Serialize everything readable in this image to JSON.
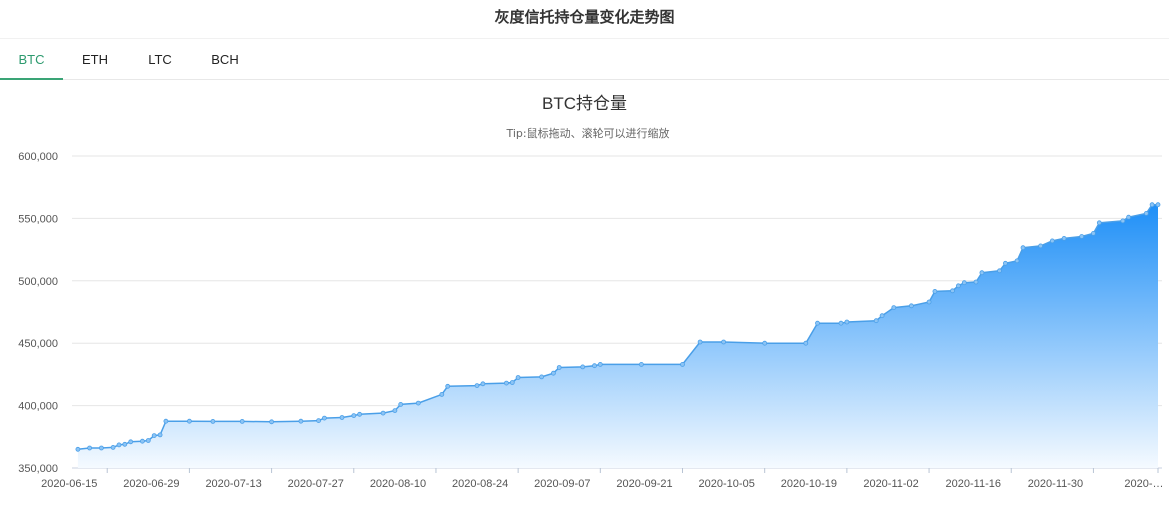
{
  "header": {
    "title": "灰度信托持仓量变化走势图"
  },
  "tabs": [
    {
      "label": "BTC",
      "active": true
    },
    {
      "label": "ETH",
      "active": false
    },
    {
      "label": "LTC",
      "active": false
    },
    {
      "label": "BCH",
      "active": false
    }
  ],
  "colors": {
    "accent": "#3aa476",
    "series": "#4a9fe8",
    "area_top": "#1e8ff7",
    "area_bottom": "#f5faff"
  },
  "chart_data": {
    "type": "area",
    "title": "BTC持仓量",
    "subtitle": "Tip:鼠标拖动、滚轮可以进行缩放",
    "xlabel": "",
    "ylabel": "",
    "ylim": [
      350000,
      600000
    ],
    "yticks": [
      350000,
      400000,
      450000,
      500000,
      550000,
      600000
    ],
    "ytick_labels": [
      "350,000",
      "400,000",
      "450,000",
      "500,000",
      "550,000",
      "600,000"
    ],
    "x_start": "2020-06-09",
    "x_end": "2020-12-11",
    "xticks": [
      "2020-06-15",
      "2020-06-29",
      "2020-07-13",
      "2020-07-27",
      "2020-08-10",
      "2020-08-24",
      "2020-09-07",
      "2020-09-21",
      "2020-10-05",
      "2020-10-19",
      "2020-11-02",
      "2020-11-16",
      "2020-11-30",
      "2020-12-14"
    ],
    "xtick_labels": [
      "2020-06-15",
      "2020-06-29",
      "2020-07-13",
      "2020-07-27",
      "2020-08-10",
      "2020-08-24",
      "2020-09-07",
      "2020-09-21",
      "2020-10-05",
      "2020-10-19",
      "2020-11-02",
      "2020-11-16",
      "2020-11-30",
      "2020-…"
    ],
    "grid": true,
    "series": [
      {
        "name": "",
        "points": [
          [
            "2020-06-10",
            365000
          ],
          [
            "2020-06-12",
            366000
          ],
          [
            "2020-06-14",
            366000
          ],
          [
            "2020-06-16",
            366500
          ],
          [
            "2020-06-17",
            368500
          ],
          [
            "2020-06-18",
            369000
          ],
          [
            "2020-06-19",
            371000
          ],
          [
            "2020-06-21",
            371500
          ],
          [
            "2020-06-22",
            372000
          ],
          [
            "2020-06-23",
            376000
          ],
          [
            "2020-06-24",
            376500
          ],
          [
            "2020-06-25",
            387500
          ],
          [
            "2020-06-29",
            387500
          ],
          [
            "2020-07-03",
            387300
          ],
          [
            "2020-07-08",
            387300
          ],
          [
            "2020-07-13",
            387000
          ],
          [
            "2020-07-18",
            387500
          ],
          [
            "2020-07-21",
            388000
          ],
          [
            "2020-07-22",
            390000
          ],
          [
            "2020-07-25",
            390500
          ],
          [
            "2020-07-27",
            392000
          ],
          [
            "2020-07-28",
            393000
          ],
          [
            "2020-08-01",
            394000
          ],
          [
            "2020-08-03",
            396000
          ],
          [
            "2020-08-04",
            401000
          ],
          [
            "2020-08-07",
            402000
          ],
          [
            "2020-08-11",
            409000
          ],
          [
            "2020-08-12",
            415500
          ],
          [
            "2020-08-17",
            416000
          ],
          [
            "2020-08-18",
            417500
          ],
          [
            "2020-08-22",
            418000
          ],
          [
            "2020-08-23",
            418500
          ],
          [
            "2020-08-24",
            422500
          ],
          [
            "2020-08-28",
            423000
          ],
          [
            "2020-08-30",
            426000
          ],
          [
            "2020-08-31",
            430500
          ],
          [
            "2020-09-04",
            431000
          ],
          [
            "2020-09-06",
            432000
          ],
          [
            "2020-09-07",
            433000
          ],
          [
            "2020-09-14",
            433000
          ],
          [
            "2020-09-21",
            433000
          ],
          [
            "2020-09-24",
            451000
          ],
          [
            "2020-09-28",
            451000
          ],
          [
            "2020-10-05",
            450000
          ],
          [
            "2020-10-12",
            450000
          ],
          [
            "2020-10-14",
            466000
          ],
          [
            "2020-10-18",
            466000
          ],
          [
            "2020-10-19",
            467000
          ],
          [
            "2020-10-24",
            468000
          ],
          [
            "2020-10-25",
            472000
          ],
          [
            "2020-10-27",
            478500
          ],
          [
            "2020-10-30",
            480000
          ],
          [
            "2020-11-02",
            483000
          ],
          [
            "2020-11-03",
            491500
          ],
          [
            "2020-11-06",
            492000
          ],
          [
            "2020-11-07",
            496000
          ],
          [
            "2020-11-08",
            498500
          ],
          [
            "2020-11-10",
            499000
          ],
          [
            "2020-11-11",
            506500
          ],
          [
            "2020-11-14",
            508000
          ],
          [
            "2020-11-15",
            514000
          ],
          [
            "2020-11-17",
            516000
          ],
          [
            "2020-11-18",
            526500
          ],
          [
            "2020-11-21",
            528000
          ],
          [
            "2020-11-23",
            532000
          ],
          [
            "2020-11-25",
            534000
          ],
          [
            "2020-11-28",
            535500
          ],
          [
            "2020-11-30",
            538000
          ],
          [
            "2020-12-01",
            546500
          ],
          [
            "2020-12-05",
            548000
          ],
          [
            "2020-12-06",
            551000
          ],
          [
            "2020-12-09",
            554000
          ],
          [
            "2020-12-10",
            561000
          ],
          [
            "2020-12-11",
            561000
          ]
        ]
      }
    ]
  }
}
